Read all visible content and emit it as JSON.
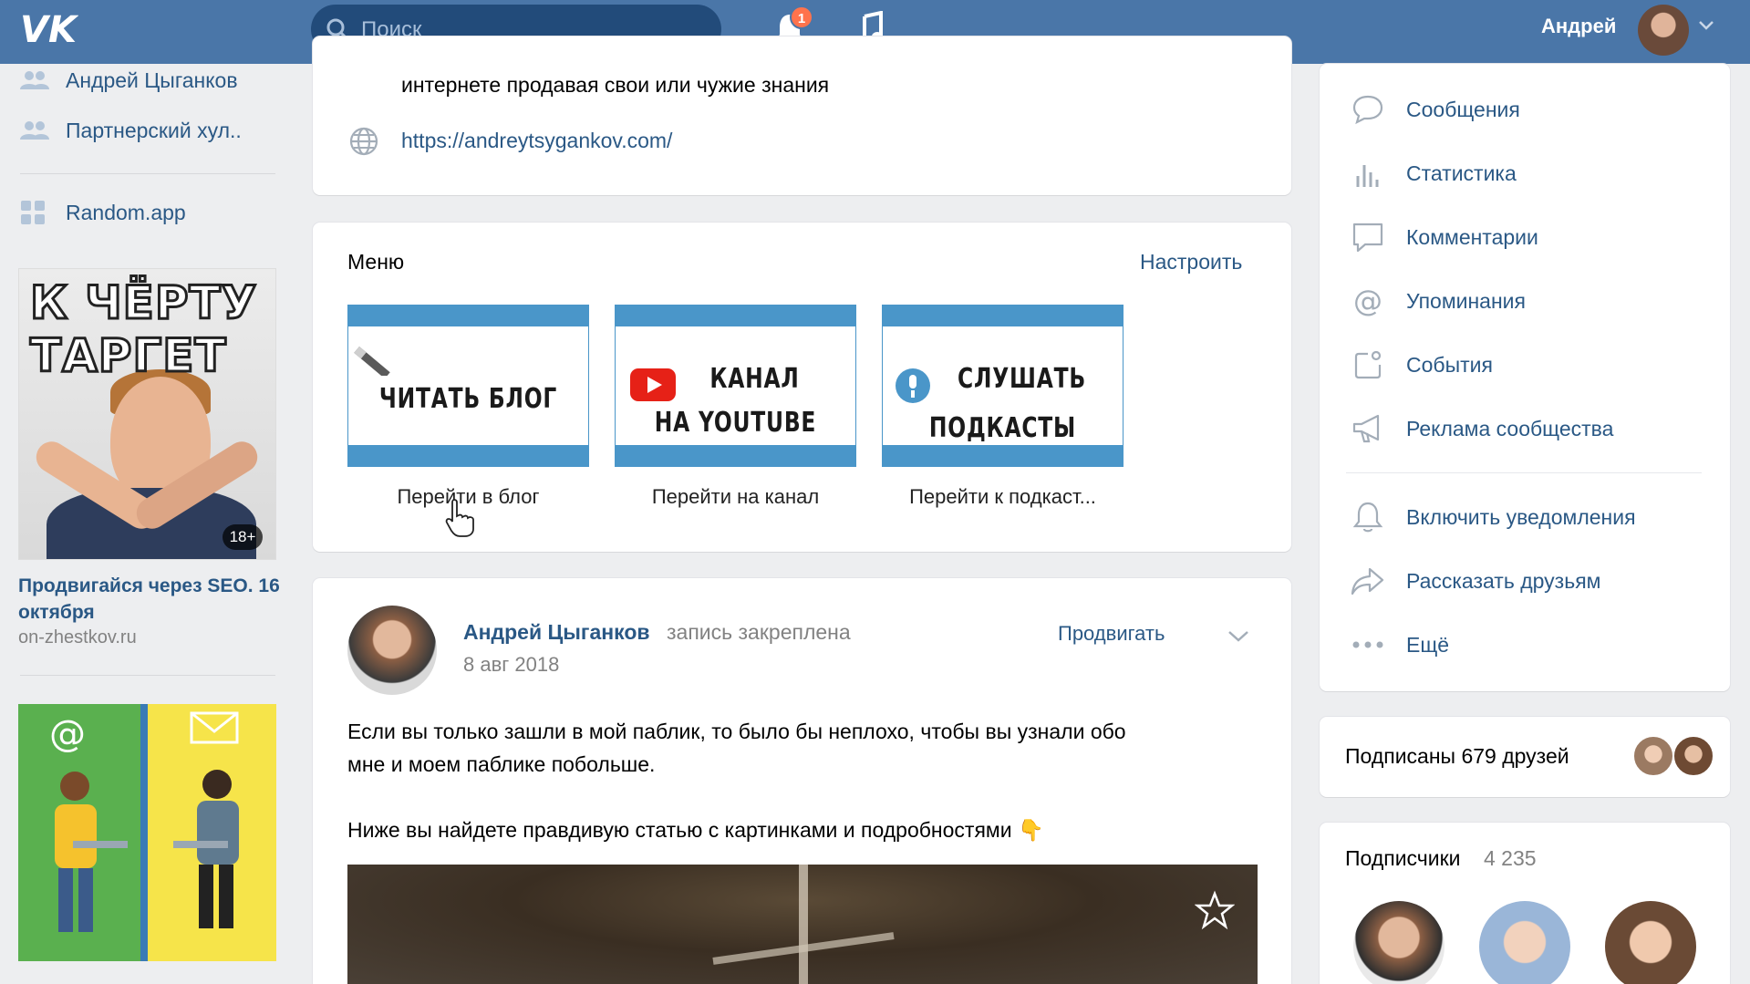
{
  "header": {
    "search_placeholder": "Поиск",
    "notification_count": "1",
    "user_name": "Андрей"
  },
  "sidebar": {
    "items": [
      {
        "label": "Андрей Цыганков",
        "icon": "group-icon"
      },
      {
        "label": "Партнерский хул..",
        "icon": "group-icon"
      },
      {
        "label": "Random.app",
        "icon": "app-icon"
      }
    ],
    "ad1": {
      "image_line1": "К ЧЁРТУ",
      "image_line2": "ТАРГЕТ",
      "age_rating": "18+",
      "title": "Продвигайся через SEO. 16 октября",
      "domain": "on-zhestkov.ru"
    }
  },
  "info_card": {
    "text": "интернете продавая свои или чужие знания",
    "link": "https://andreytsygankov.com/"
  },
  "menu_card": {
    "title": "Меню",
    "configure": "Настроить",
    "tiles": [
      {
        "image_lines": [
          "ЧИТАТЬ БЛОГ"
        ],
        "caption": "Перейти в блог"
      },
      {
        "image_lines": [
          "КАНАЛ",
          "НА YOUTUBE"
        ],
        "caption": "Перейти на канал"
      },
      {
        "image_lines": [
          "СЛУШАТЬ",
          "ПОДКАСТЫ"
        ],
        "caption": "Перейти к подкаст..."
      }
    ]
  },
  "post": {
    "author": "Андрей Цыганков",
    "pinned_note": "запись закреплена",
    "date": "8 авг 2018",
    "promote": "Продвигать",
    "paragraph1_line1": "Если вы только зашли в мой паблик, то было бы неплохо, чтобы вы узнали обо",
    "paragraph1_line2": "мне и моем паблике побольше.",
    "paragraph2": "Ниже вы найдете правдивую статью с картинками и подробностями 👇"
  },
  "right_menu": {
    "items": [
      {
        "label": "Сообщения",
        "icon": "message-icon"
      },
      {
        "label": "Статистика",
        "icon": "stats-icon"
      },
      {
        "label": "Комментарии",
        "icon": "comment-icon"
      },
      {
        "label": "Упоминания",
        "icon": "at-icon"
      },
      {
        "label": "События",
        "icon": "event-icon"
      },
      {
        "label": "Реклама сообщества",
        "icon": "megaphone-icon"
      }
    ],
    "items2": [
      {
        "label": "Включить уведомления",
        "icon": "bell-icon"
      },
      {
        "label": "Рассказать друзьям",
        "icon": "share-icon"
      },
      {
        "label": "Ещё",
        "icon": "more-icon"
      }
    ],
    "friends_subscribed": "Подписаны 679 друзей",
    "subscribers_label": "Подписчики",
    "subscribers_count": "4 235"
  },
  "colors": {
    "header_bg": "#4a76a8",
    "link": "#2a5885",
    "page_bg": "#edeef0",
    "tile_accent": "#4a96c9"
  }
}
